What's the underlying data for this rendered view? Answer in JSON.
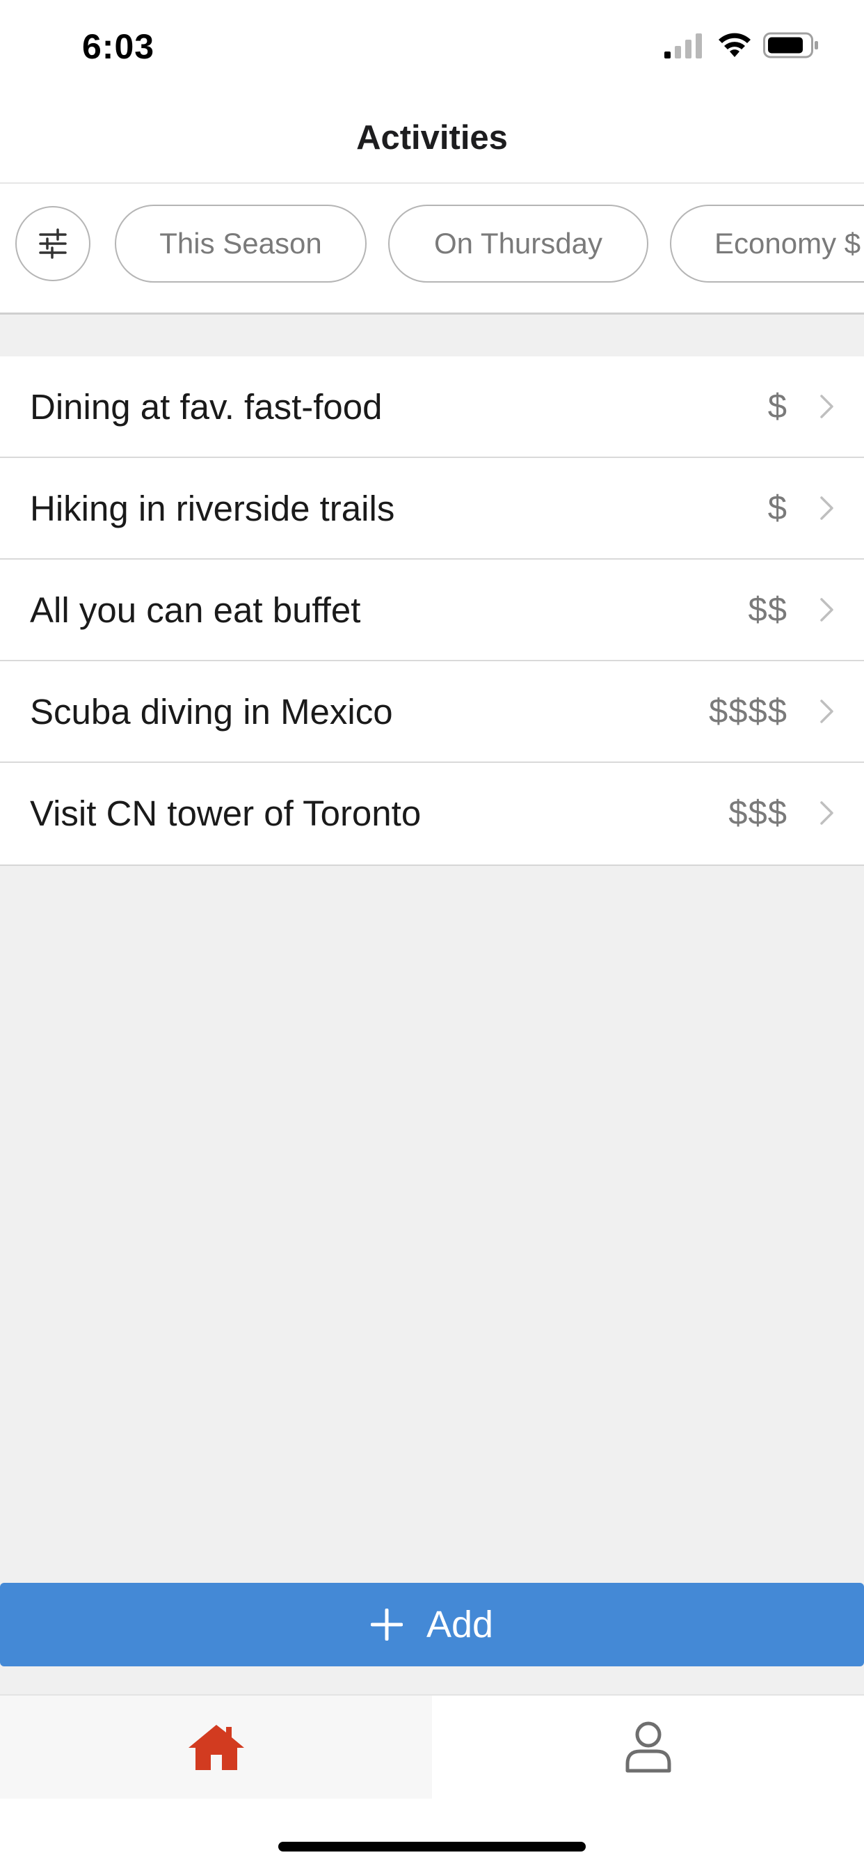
{
  "status_bar": {
    "time": "6:03"
  },
  "header": {
    "title": "Activities"
  },
  "filters": {
    "settings_icon": "sliders-icon",
    "chips": [
      "This Season",
      "On Thursday",
      "Economy $"
    ]
  },
  "activities": [
    {
      "title": "Dining at fav. fast-food",
      "price": "$"
    },
    {
      "title": "Hiking in riverside trails",
      "price": "$"
    },
    {
      "title": "All you can eat buffet",
      "price": "$$"
    },
    {
      "title": "Scuba diving in Mexico",
      "price": "$$$$"
    },
    {
      "title": "Visit CN tower of Toronto",
      "price": "$$$"
    }
  ],
  "add_button": {
    "label": "Add"
  },
  "tab_bar": {
    "tabs": [
      {
        "icon": "home-icon",
        "active": true
      },
      {
        "icon": "user-icon",
        "active": false
      }
    ]
  },
  "colors": {
    "accent": "#4489d6",
    "active_tab": "#d23b20",
    "inactive_tab": "#6e6e6e",
    "background": "#f0f0f0"
  }
}
